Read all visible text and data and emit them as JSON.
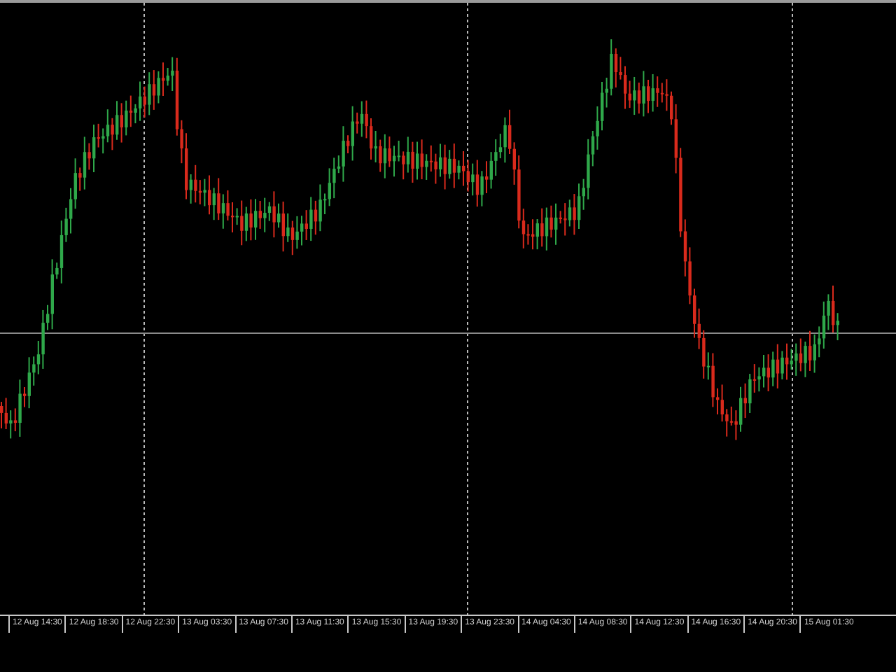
{
  "chart": {
    "kind": "picture",
    "time_axis": [
      "12 Aug 14:30",
      "12 Aug 18:30",
      "12 Aug 22:30",
      "13 Aug 03:30",
      "13 Aug 07:30",
      "13 Aug 11:30",
      "13 Aug 15:30",
      "13 Aug 19:30",
      "13 Aug 23:30",
      "14 Aug 04:30",
      "14 Aug 08:30",
      "14 Aug 12:30",
      "14 Aug 16:30",
      "14 Aug 20:30",
      "15 Aug 01:30"
    ]
  }
}
